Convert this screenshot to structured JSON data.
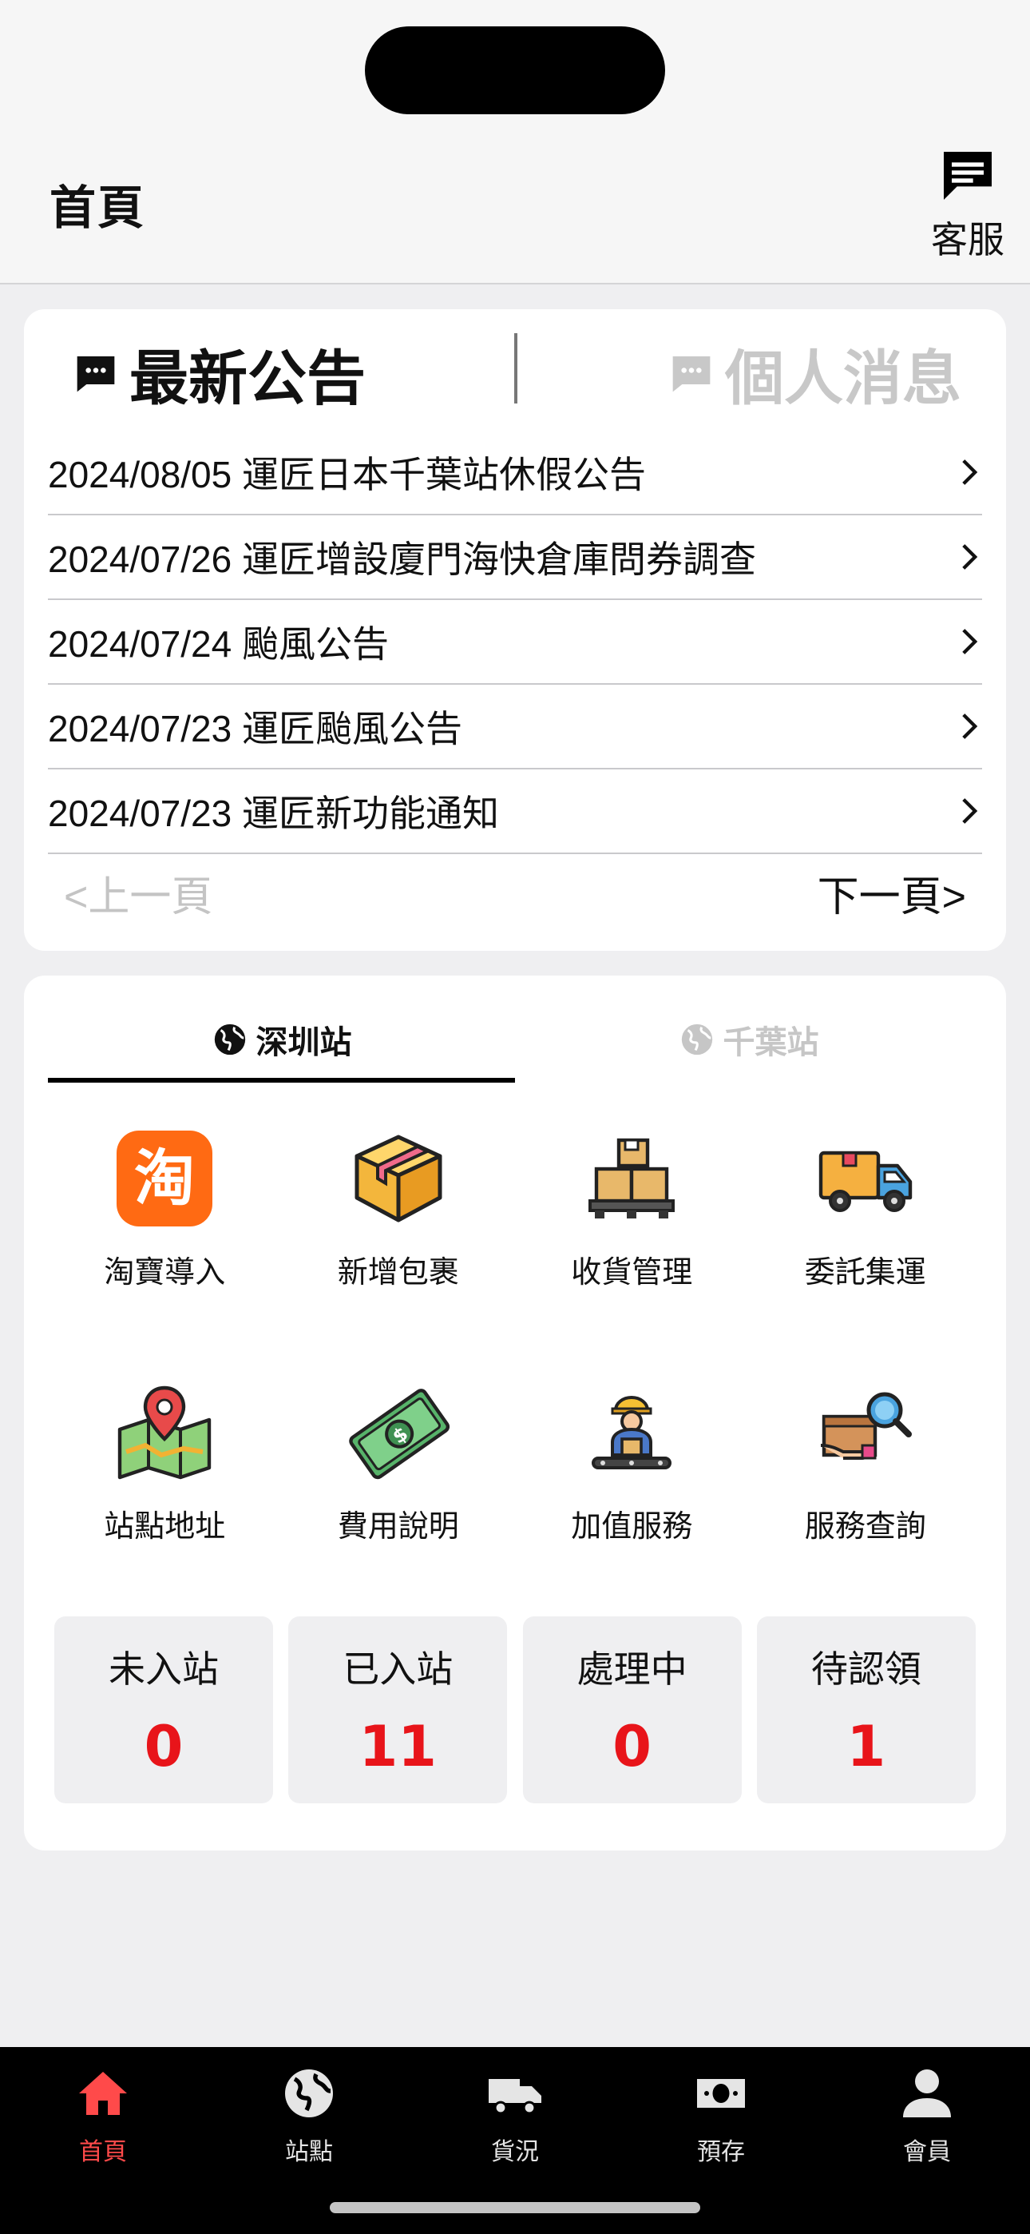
{
  "header": {
    "title": "首頁",
    "customer_service_label": "客服"
  },
  "news": {
    "tabs": [
      {
        "label": "最新公告",
        "active": true
      },
      {
        "label": "個人消息",
        "active": false
      }
    ],
    "items": [
      {
        "text": "2024/08/05 運匠日本千葉站休假公告"
      },
      {
        "text": "2024/07/26 運匠增設廈門海快倉庫問券調查"
      },
      {
        "text": "2024/07/24 颱風公告"
      },
      {
        "text": "2024/07/23 運匠颱風公告"
      },
      {
        "text": "2024/07/23 運匠新功能通知"
      }
    ],
    "prev_label": "<上一頁",
    "next_label": "下一頁>"
  },
  "stations": {
    "tabs": [
      {
        "label": "深圳站",
        "active": true
      },
      {
        "label": "千葉站",
        "active": false
      }
    ],
    "features": [
      {
        "label": "淘寶導入",
        "icon": "taobao-icon"
      },
      {
        "label": "新增包裹",
        "icon": "package-icon"
      },
      {
        "label": "收貨管理",
        "icon": "pallet-boxes-icon"
      },
      {
        "label": "委託集運",
        "icon": "delivery-truck-icon"
      },
      {
        "label": "站點地址",
        "icon": "map-pin-icon"
      },
      {
        "label": "費用說明",
        "icon": "money-icon"
      },
      {
        "label": "加值服務",
        "icon": "worker-icon"
      },
      {
        "label": "服務查詢",
        "icon": "search-box-icon"
      }
    ],
    "stats": [
      {
        "label": "未入站",
        "value": "0"
      },
      {
        "label": "已入站",
        "value": "11"
      },
      {
        "label": "處理中",
        "value": "0"
      },
      {
        "label": "待認領",
        "value": "1"
      }
    ]
  },
  "bottom_nav": [
    {
      "label": "首頁",
      "icon": "home-icon",
      "active": true
    },
    {
      "label": "站點",
      "icon": "globe-icon",
      "active": false
    },
    {
      "label": "貨況",
      "icon": "truck-icon",
      "active": false
    },
    {
      "label": "預存",
      "icon": "cash-icon",
      "active": false
    },
    {
      "label": "會員",
      "icon": "person-icon",
      "active": false
    }
  ],
  "colors": {
    "accent_red": "#e8141a",
    "nav_active": "#ff4a4a",
    "taobao_orange": "#ff6a13"
  }
}
